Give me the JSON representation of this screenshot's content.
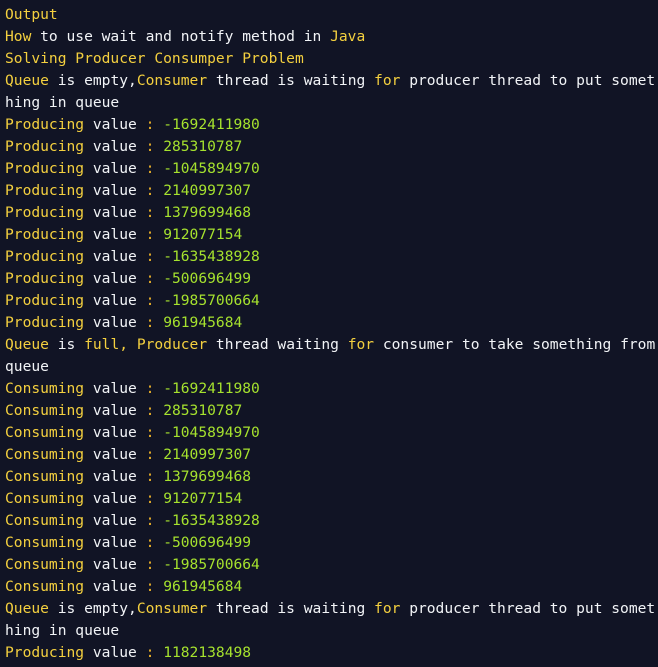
{
  "panel": {
    "name": "output-console",
    "title": "Output",
    "background_color": "#111425",
    "text_color": "#f2f4f7",
    "keyword_color": "#f4d03f",
    "number_color": "#a6e22e",
    "punctuation_color": "#f0b429"
  },
  "labels": {
    "producing": "Producing",
    "consuming": "Consuming",
    "value_word": "value",
    "colon": ":",
    "queue_word": "Queue",
    "is_word": "is",
    "empty_word": "empty,",
    "full_word": "full,",
    "consumer_word": "Consumer",
    "producer_word": "Producer",
    "for_word": "for",
    "java_word": "Java",
    "how_word": "How"
  },
  "lines": [
    {
      "id": "line-output-title",
      "type": "title",
      "text": "Output"
    },
    {
      "id": "line-heading-1",
      "type": "mixed",
      "parts": [
        {
          "cls": "kw",
          "t": "How"
        },
        {
          "cls": "plain",
          "t": " to use wait and notify method in "
        },
        {
          "cls": "kw",
          "t": "Java"
        }
      ]
    },
    {
      "id": "line-heading-2",
      "type": "mixed",
      "parts": [
        {
          "cls": "kw",
          "t": "Solving Producer Consumper Problem"
        }
      ]
    },
    {
      "id": "line-queue-empty-1",
      "type": "mixed",
      "parts": [
        {
          "cls": "kw",
          "t": "Queue"
        },
        {
          "cls": "plain",
          "t": " is empty,"
        },
        {
          "cls": "kw",
          "t": "Consumer"
        },
        {
          "cls": "plain",
          "t": " thread is waiting "
        },
        {
          "cls": "kw",
          "t": "for"
        },
        {
          "cls": "plain",
          "t": " producer thread to put something in queue"
        }
      ]
    },
    {
      "id": "line-producing-1",
      "type": "value",
      "label": "Producing",
      "value": "-1692411980"
    },
    {
      "id": "line-producing-2",
      "type": "value",
      "label": "Producing",
      "value": "285310787"
    },
    {
      "id": "line-producing-3",
      "type": "value",
      "label": "Producing",
      "value": "-1045894970"
    },
    {
      "id": "line-producing-4",
      "type": "value",
      "label": "Producing",
      "value": "2140997307"
    },
    {
      "id": "line-producing-5",
      "type": "value",
      "label": "Producing",
      "value": "1379699468"
    },
    {
      "id": "line-producing-6",
      "type": "value",
      "label": "Producing",
      "value": "912077154"
    },
    {
      "id": "line-producing-7",
      "type": "value",
      "label": "Producing",
      "value": "-1635438928"
    },
    {
      "id": "line-producing-8",
      "type": "value",
      "label": "Producing",
      "value": "-500696499"
    },
    {
      "id": "line-producing-9",
      "type": "value",
      "label": "Producing",
      "value": "-1985700664"
    },
    {
      "id": "line-producing-10",
      "type": "value",
      "label": "Producing",
      "value": "961945684"
    },
    {
      "id": "line-queue-full",
      "type": "mixed",
      "parts": [
        {
          "cls": "kw",
          "t": "Queue"
        },
        {
          "cls": "plain",
          "t": " is "
        },
        {
          "cls": "kw",
          "t": "full,"
        },
        {
          "cls": "plain",
          "t": " "
        },
        {
          "cls": "kw",
          "t": "Producer"
        },
        {
          "cls": "plain",
          "t": " thread waiting "
        },
        {
          "cls": "kw",
          "t": "for"
        },
        {
          "cls": "plain",
          "t": " consumer to take something from queue"
        }
      ]
    },
    {
      "id": "line-consuming-1",
      "type": "value",
      "label": "Consuming",
      "value": "-1692411980"
    },
    {
      "id": "line-consuming-2",
      "type": "value",
      "label": "Consuming",
      "value": "285310787"
    },
    {
      "id": "line-consuming-3",
      "type": "value",
      "label": "Consuming",
      "value": "-1045894970"
    },
    {
      "id": "line-consuming-4",
      "type": "value",
      "label": "Consuming",
      "value": "2140997307"
    },
    {
      "id": "line-consuming-5",
      "type": "value",
      "label": "Consuming",
      "value": "1379699468"
    },
    {
      "id": "line-consuming-6",
      "type": "value",
      "label": "Consuming",
      "value": "912077154"
    },
    {
      "id": "line-consuming-7",
      "type": "value",
      "label": "Consuming",
      "value": "-1635438928"
    },
    {
      "id": "line-consuming-8",
      "type": "value",
      "label": "Consuming",
      "value": "-500696499"
    },
    {
      "id": "line-consuming-9",
      "type": "value",
      "label": "Consuming",
      "value": "-1985700664"
    },
    {
      "id": "line-consuming-10",
      "type": "value",
      "label": "Consuming",
      "value": "961945684"
    },
    {
      "id": "line-queue-empty-2",
      "type": "mixed",
      "parts": [
        {
          "cls": "kw",
          "t": "Queue"
        },
        {
          "cls": "plain",
          "t": " is empty,"
        },
        {
          "cls": "kw",
          "t": "Consumer"
        },
        {
          "cls": "plain",
          "t": " thread is waiting "
        },
        {
          "cls": "kw",
          "t": "for"
        },
        {
          "cls": "plain",
          "t": " producer thread to put something in queue"
        }
      ]
    },
    {
      "id": "line-producing-11",
      "type": "value",
      "label": "Producing",
      "value": "1182138498"
    }
  ]
}
